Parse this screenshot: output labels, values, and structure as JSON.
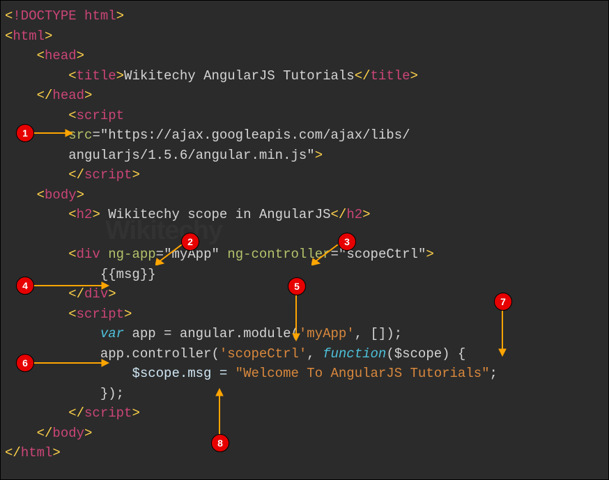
{
  "code": {
    "doctype_open": "<",
    "doctype_kw": "!DOCTYPE html",
    "doctype_close": ">",
    "html_open": "html",
    "head_open": "head",
    "title": "title",
    "title_text": "Wikitechy AngularJS Tutorials",
    "script": "script",
    "src_attr": "src",
    "src_eq": "=",
    "src_val1": "\"https://ajax.googleapis.com/ajax/libs/",
    "src_val2": "angularjs/1.5.6/angular.min.js\"",
    "body": "body",
    "h2": "h2",
    "h2_text": " Wikitechy scope in AngularJS",
    "div": "div",
    "ngapp": "ng-app",
    "ngapp_val": "=\"myApp\"",
    "ngcontroller": "ng-controller",
    "ngcontroller_val": "=\"scopeCtrl\"",
    "expr": "{{msg}}",
    "var": "var",
    "app_line": " app = angular.module(",
    "app_arg": "'myApp'",
    "app_rest": ", []);",
    "ctrl_line": "app.controller(",
    "ctrl_arg": "'scopeCtrl'",
    "ctrl_sep": ", ",
    "function_kw": "function",
    "ctrl_rest": "($scope) {",
    "scope_line": "$scope.msg = ",
    "scope_val": "\"Welcome To AngularJS Tutorials\"",
    "scope_semi": ";",
    "close_brace": "});"
  },
  "badges": {
    "b1": "1",
    "b2": "2",
    "b3": "3",
    "b4": "4",
    "b5": "5",
    "b6": "6",
    "b7": "7",
    "b8": "8"
  },
  "watermark": "Wikitechy"
}
